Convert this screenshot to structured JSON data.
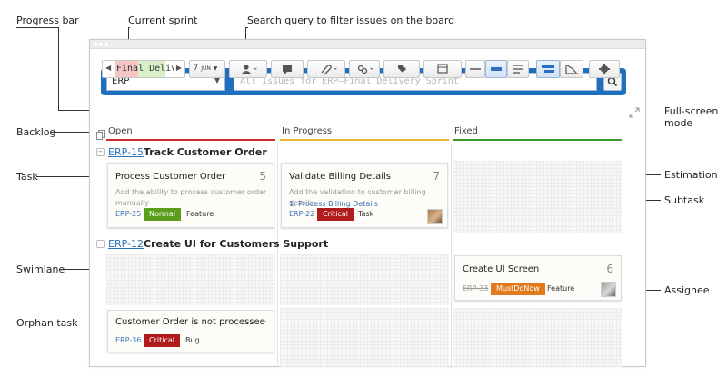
{
  "annotations": {
    "progress_bar": "Progress bar",
    "current_sprint": "Current sprint",
    "search_query": "Search query to filter issues on the board",
    "full_screen": "Full-screen",
    "full_screen_2": "mode",
    "backlog": "Backlog",
    "task": "Task",
    "estimation": "Estimation",
    "subtask": "Subtask",
    "swimlane": "Swimlane",
    "assignee": "Assignee",
    "orphan_task": "Orphan task"
  },
  "search_bar": {
    "project": "ERP",
    "placeholder": "All issues for ERP—Final Delivery Sprint"
  },
  "sprint": {
    "name": "Final Deliv",
    "progress": {
      "red_fraction": 0.4,
      "green_fraction": 0.45
    }
  },
  "toolbar": {
    "date_day": "7",
    "date_month": "JUN"
  },
  "columns": [
    {
      "label": "Open",
      "color": "#cc2b2b"
    },
    {
      "label": "In Progress",
      "color": "#e6b82e"
    },
    {
      "label": "Fixed",
      "color": "#3a9b2e"
    }
  ],
  "swimlanes": [
    {
      "key": "ERP-15",
      "title": "Track Customer Order"
    },
    {
      "key": "ERP-12",
      "title": "Create UI for Customers Support"
    }
  ],
  "cards": {
    "c1": {
      "title": "Process Customer Order",
      "estimate": "5",
      "desc1": "Add the ability to process customer order",
      "desc2": "manually",
      "key": "ERP-25",
      "priority": "Normal",
      "priority_color": "#5a9e1c",
      "type": "Feature"
    },
    "c2": {
      "title": "Validate Billing Details",
      "estimate": "7",
      "desc1": "Add the validation to customer billing details",
      "subtask": "1. Process Billing Details",
      "key": "ERP-22",
      "priority": "Critical",
      "priority_color": "#b01c1c",
      "type": "Task"
    },
    "c3": {
      "title": "Create UI Screen",
      "estimate": "6",
      "key": "ERP-33",
      "priority": "MustDoNow",
      "priority_color": "#e07a1c",
      "type": "Feature"
    },
    "c4": {
      "title": "Customer Order is not processed",
      "estimate": "–",
      "key": "ERP-36",
      "priority": "Critical",
      "priority_color": "#b01c1c",
      "type": "Bug"
    }
  }
}
